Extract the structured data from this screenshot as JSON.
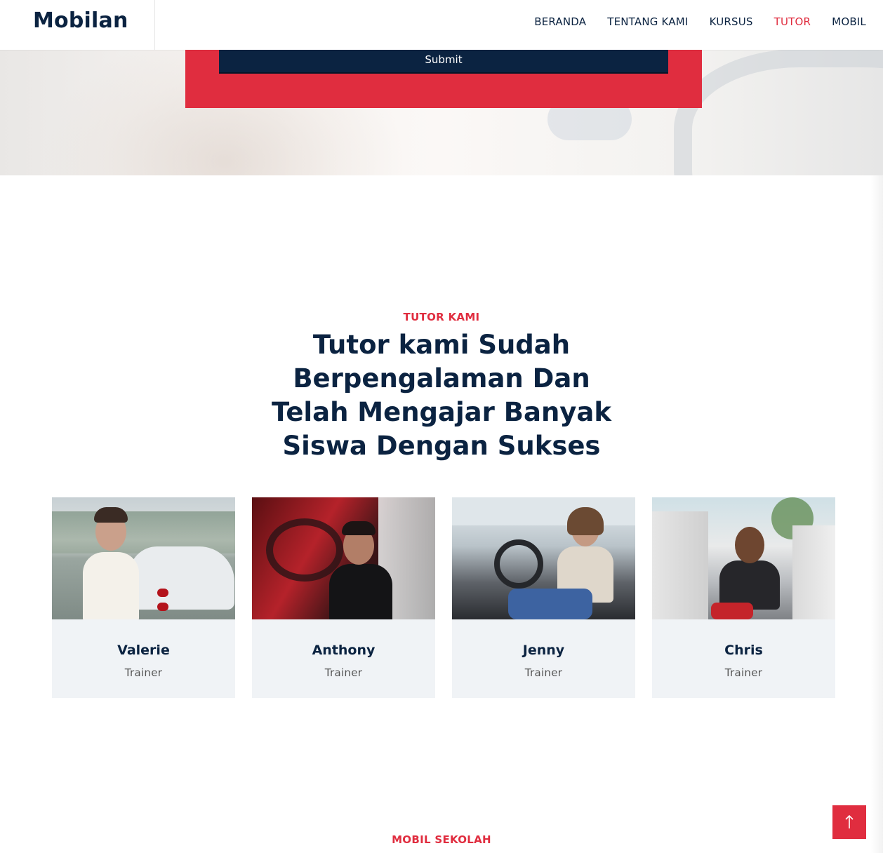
{
  "header": {
    "brand": "Mobilan",
    "nav": [
      {
        "label": "BERANDA",
        "active": false
      },
      {
        "label": "TENTANG KAMI",
        "active": false
      },
      {
        "label": "KURSUS",
        "active": false
      },
      {
        "label": "TUTOR",
        "active": true
      },
      {
        "label": "MOBIL",
        "active": false
      }
    ]
  },
  "form": {
    "submit_label": "Submit"
  },
  "tutors": {
    "eyebrow": "TUTOR KAMI",
    "title": "Tutor kami Sudah Berpengalaman Dan Telah Mengajar Banyak Siswa Dengan Sukses",
    "cards": [
      {
        "name": "Valerie",
        "role": "Trainer",
        "photo": "man-with-white-car-photo"
      },
      {
        "name": "Anthony",
        "role": "Trainer",
        "photo": "man-in-red-car-photo"
      },
      {
        "name": "Jenny",
        "role": "Trainer",
        "photo": "woman-driving-car-photo"
      },
      {
        "name": "Chris",
        "role": "Trainer",
        "photo": "man-sitting-in-jeep-photo"
      }
    ]
  },
  "next_section": {
    "eyebrow": "MOBIL SEKOLAH"
  },
  "scroll_top": {
    "icon": "arrow-up-icon"
  },
  "colors": {
    "accent": "#e02d3f",
    "navy": "#0b2341",
    "card_bg": "#f0f3f6"
  }
}
